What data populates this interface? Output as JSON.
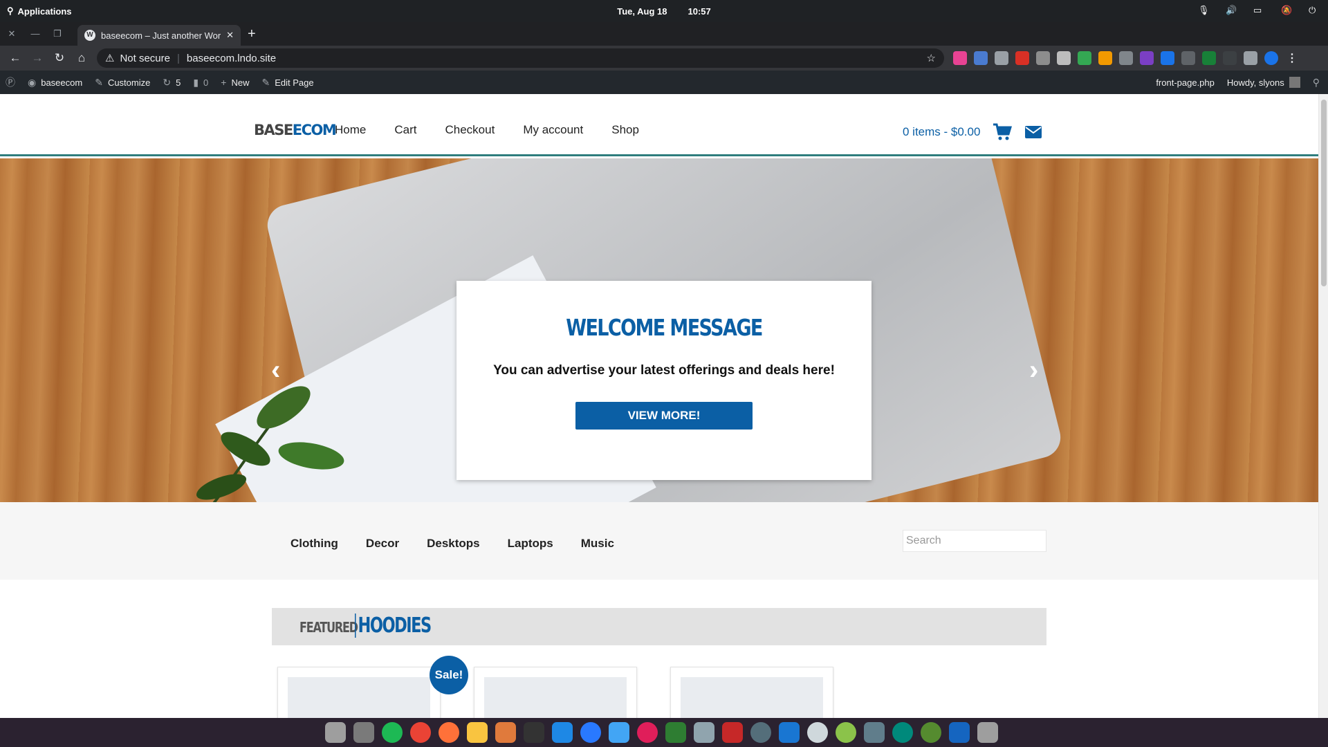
{
  "os": {
    "apps_label": "Applications",
    "date": "Tue, Aug 18",
    "time": "10:57"
  },
  "browser": {
    "tab_title": "baseecom – Just another Word",
    "url_warning": "Not secure",
    "url": "baseecom.lndo.site"
  },
  "adminbar": {
    "site": "baseecom",
    "customize": "Customize",
    "updates": "5",
    "comments": "0",
    "new": "New",
    "edit": "Edit Page",
    "template": "front-page.php",
    "howdy": "Howdy, slyons"
  },
  "site": {
    "logo_a": "BASE",
    "logo_b": "ECOM",
    "nav": [
      "Home",
      "Cart",
      "Checkout",
      "My account",
      "Shop"
    ],
    "cart": "0 items - $0.00"
  },
  "hero": {
    "title": "WELCOME MESSAGE",
    "text": "You can advertise your latest offerings and deals here!",
    "button": "VIEW MORE!"
  },
  "categories": [
    "Clothing",
    "Decor",
    "Desktops",
    "Laptops",
    "Music"
  ],
  "search_placeholder": "Search",
  "featured": {
    "small": "FEATURED",
    "big": "HOODIES",
    "sale_badge": "Sale!"
  },
  "colors": {
    "brand_blue": "#0b5fa5",
    "admin_bar": "#23282d"
  }
}
